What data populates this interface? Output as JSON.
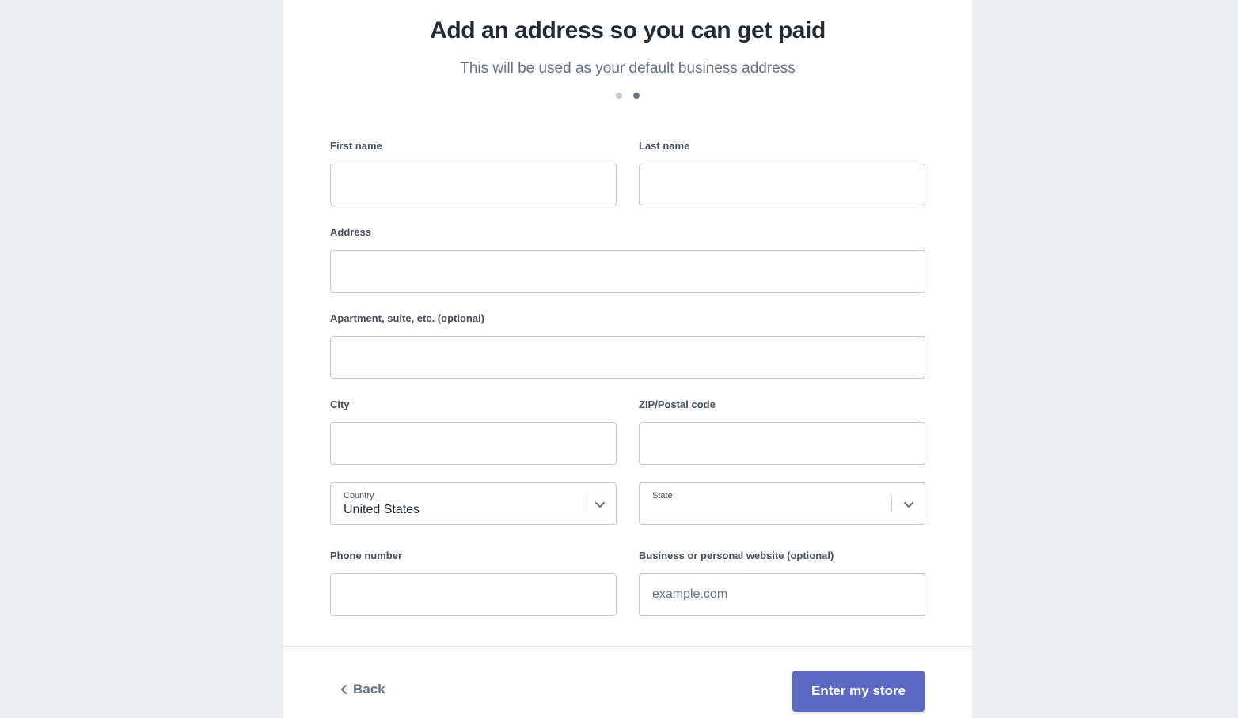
{
  "header": {
    "title": "Add an address so you can get paid",
    "subtitle": "This will be used as your default business address",
    "steps": {
      "total": 2,
      "current": 2
    }
  },
  "form": {
    "first_name": {
      "label": "First name",
      "value": "",
      "placeholder": ""
    },
    "last_name": {
      "label": "Last name",
      "value": "",
      "placeholder": ""
    },
    "address": {
      "label": "Address",
      "value": "",
      "placeholder": ""
    },
    "apartment": {
      "label": "Apartment, suite, etc. (optional)",
      "value": "",
      "placeholder": ""
    },
    "city": {
      "label": "City",
      "value": "",
      "placeholder": ""
    },
    "zip": {
      "label": "ZIP/Postal code",
      "value": "",
      "placeholder": ""
    },
    "country": {
      "label": "Country",
      "value": "United States",
      "icon": "chevron-down-icon"
    },
    "state": {
      "label": "State",
      "value": "",
      "icon": "chevron-down-icon"
    },
    "phone": {
      "label": "Phone number",
      "value": "",
      "placeholder": ""
    },
    "website": {
      "label": "Business or personal website (optional)",
      "value": "",
      "placeholder": "example.com"
    }
  },
  "footer": {
    "back_label": "Back",
    "back_icon": "chevron-left-icon",
    "submit_label": "Enter my store",
    "submit_color": "#5c6ac4"
  }
}
